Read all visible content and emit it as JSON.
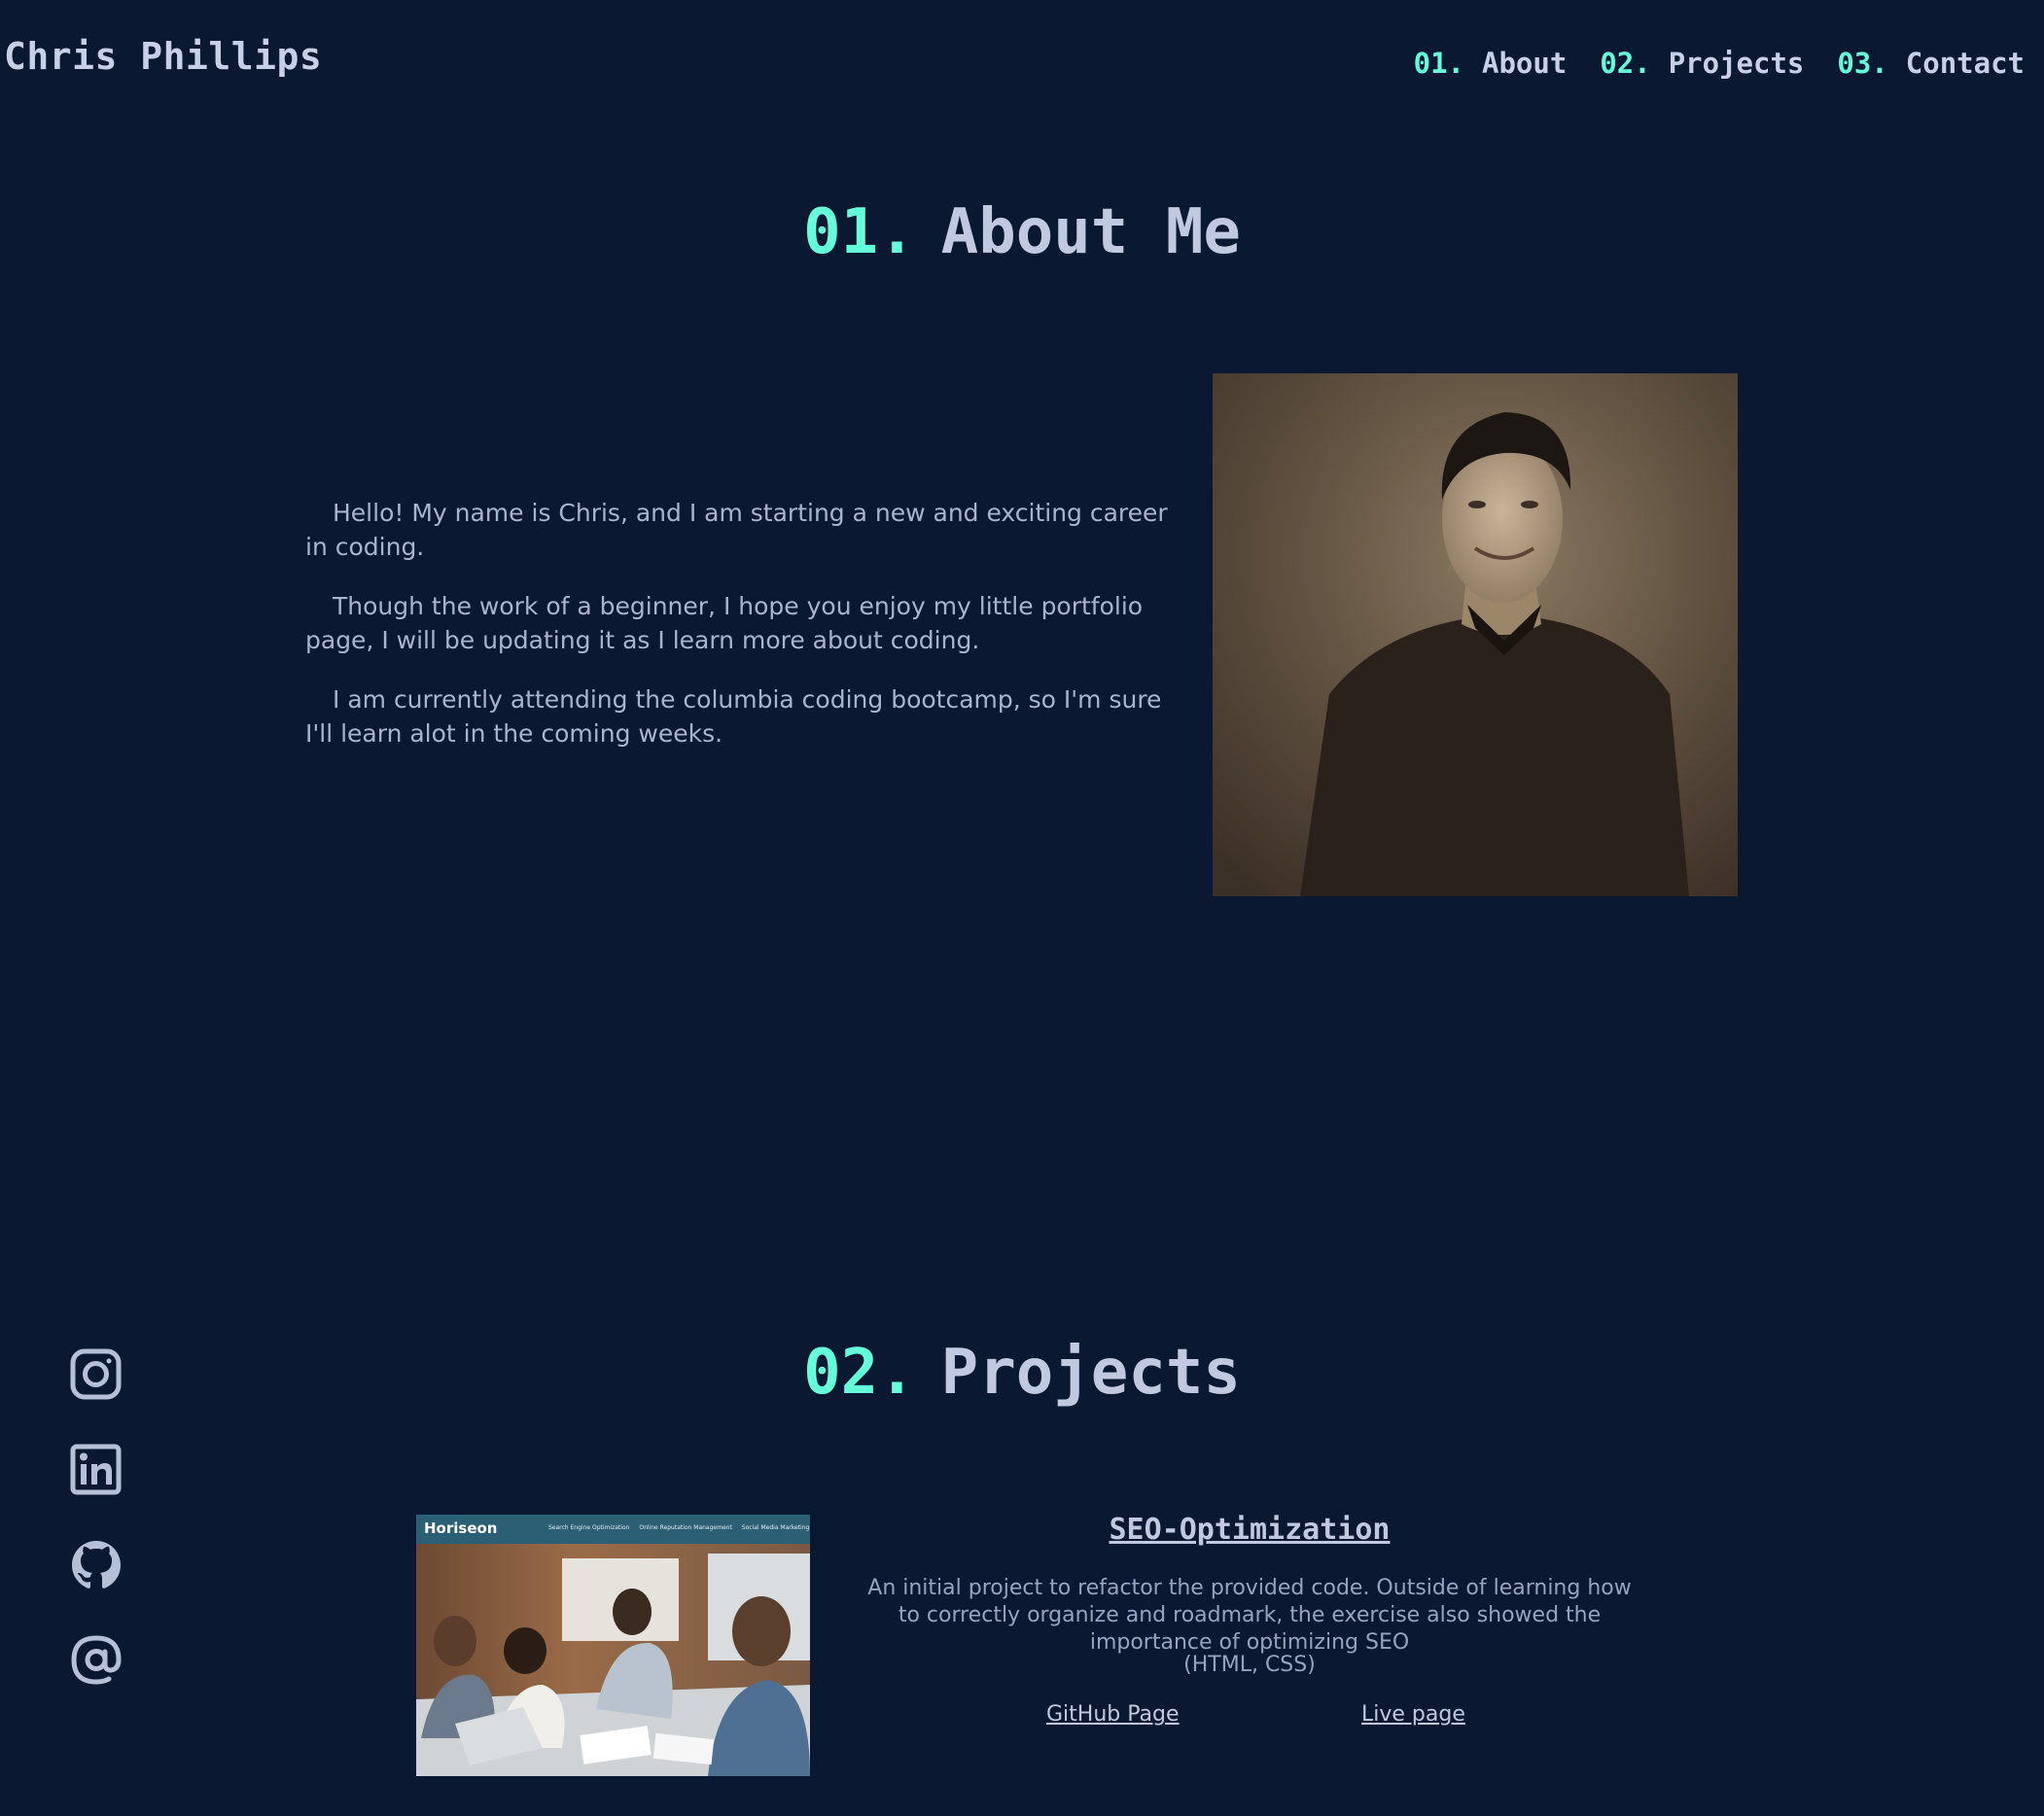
{
  "header": {
    "brand": "Chris Phillips",
    "nav": [
      {
        "num": "01.",
        "label": "About"
      },
      {
        "num": "02.",
        "label": "Projects"
      },
      {
        "num": "03.",
        "label": "Contact"
      }
    ]
  },
  "about": {
    "num": "01.",
    "title": "About Me",
    "paragraphs": [
      "Hello! My name is Chris, and I am starting a new and exciting career in coding.",
      "Though the work of a beginner, I hope you enjoy my little portfolio page, I will be updating it as I learn more about coding.",
      "I am currently attending the columbia coding bootcamp, so I'm sure I'll learn alot in the coming weeks."
    ]
  },
  "projects": {
    "num": "02.",
    "title": "Projects",
    "items": [
      {
        "thumb_brand": "Horiseon",
        "thumb_nav": [
          "Search Engine Optimization",
          "Online Reputation Management",
          "Social Media Marketing"
        ],
        "name": "SEO-Optimization",
        "description": "An initial project to refactor the provided code. Outside of learning how to correctly organize and roadmark, the exercise also showed the importance of optimizing SEO",
        "tech": "(HTML, CSS)",
        "github_label": "GitHub Page",
        "live_label": "Live page"
      }
    ]
  },
  "social": [
    "instagram-icon",
    "linkedin-icon",
    "github-icon",
    "at-sign-icon"
  ],
  "colors": {
    "background": "#0a1931",
    "accent": "#64ffda",
    "text": "#b5bfd8"
  }
}
